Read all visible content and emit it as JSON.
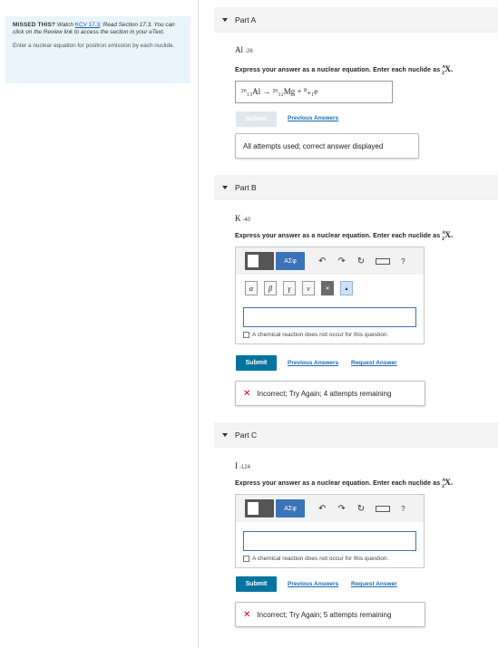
{
  "hint": {
    "missed": "MISSED THIS?",
    "watch_prefix": "Watch",
    "watch_link": "KCV 17.3",
    "rest": "; Read Section 17.3. You can click on the Review link to access the section in your eText.",
    "task": "Enter a nuclear equation for positron emission by each nuclide."
  },
  "instruction": "Express your answer as a nuclear equation. Enter each nuclide as",
  "instruction_symbol": "AZX.",
  "parts": [
    {
      "label": "Part A",
      "element": "Al",
      "mass": "-26",
      "answer": "²⁶₁₃Al → ²⁶₁₂Mg + ⁰₊₁e",
      "submit": "Submit",
      "previous": "Previous Answers",
      "feedback": "All attempts used; correct answer displayed"
    },
    {
      "label": "Part B",
      "element": "K",
      "mass": "-40",
      "submit": "Submit",
      "previous": "Previous Answers",
      "request": "Request Answer",
      "no_reaction": "A chemical reaction does not occur for this question.",
      "feedback": "Incorrect; Try Again; 4 attempts remaining"
    },
    {
      "label": "Part C",
      "element": "I",
      "mass": "-124",
      "submit": "Submit",
      "previous": "Previous Answers",
      "request": "Request Answer",
      "no_reaction": "A chemical reaction does not occur for this question.",
      "feedback": "Incorrect; Try Again; 5 attempts remaining"
    }
  ],
  "toolbar": {
    "greek_label": "ΑΣφ",
    "keys": [
      "α",
      "β",
      "γ",
      "ν"
    ],
    "help": "?"
  },
  "colors": {
    "submit": "#00749f",
    "link": "#1a6ab5",
    "error": "#d0021b",
    "hint_bg": "#e9f4fb"
  }
}
